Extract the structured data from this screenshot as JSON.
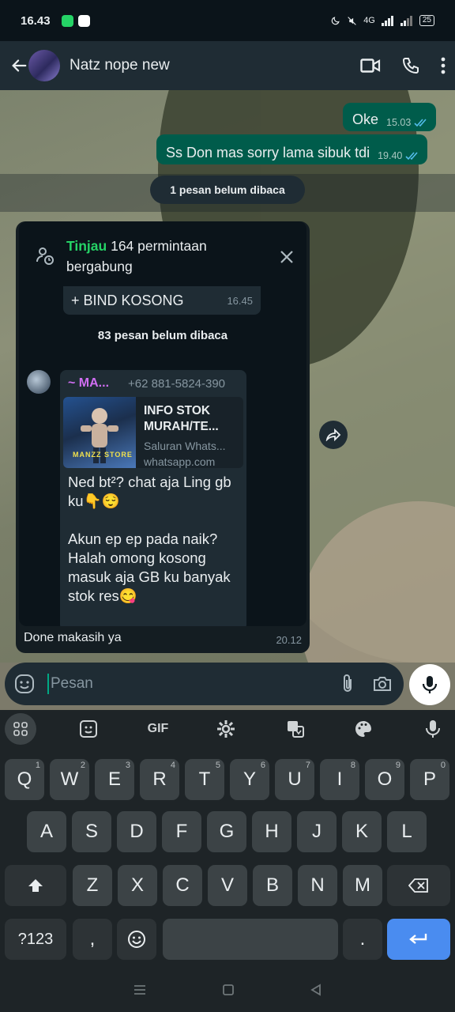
{
  "status_bar": {
    "time": "16.43",
    "signal_text": "4G",
    "battery": "25",
    "app_colors": [
      "#25d366",
      "#ffffff"
    ]
  },
  "top_bar": {
    "contact_name": "Natz nope new",
    "icons": [
      "back-arrow-icon",
      "video-call-icon",
      "voice-call-icon",
      "more-options-icon"
    ]
  },
  "chat": {
    "outgoing": [
      {
        "text": "Oke",
        "time": "15.03",
        "status": "read"
      },
      {
        "text": "Ss Don mas sorry lama sibuk tdi",
        "time": "19.40",
        "status": "read"
      }
    ],
    "unread_banner": "1 pesan belum dibaca",
    "screenshot_message": {
      "request_link": "Tinjau",
      "request_text": " 164 permintaan bergabung",
      "bind_text": "+ BIND KOSONG",
      "bind_time": "16.45",
      "inner_unread": "83 pesan belum dibaca",
      "sender": "~ MA...",
      "phone": "+62 881-5824-390",
      "link_title": "INFO STOK MURAH/TE...",
      "link_desc1": "Saluran Whats...",
      "link_desc2": "whatsapp.com",
      "thumb_label": "MANZZ STORE",
      "body": "Ned bt²? chat aja Ling gb ku👇😌\n\nAkun ep ep pada naik? Halah omong kosong masuk aja GB ku banyak stok res😋",
      "caption": "Done makasih ya",
      "time": "20.12"
    }
  },
  "composer": {
    "placeholder": "Pesan"
  },
  "keyboard": {
    "toolbar": [
      "apps-icon",
      "sticker-icon",
      "GIF",
      "settings-icon",
      "translate-icon",
      "theme-icon",
      "mic-icon"
    ],
    "gif_label": "GIF",
    "row1": [
      {
        "k": "Q",
        "h": "1"
      },
      {
        "k": "W",
        "h": "2"
      },
      {
        "k": "E",
        "h": "3"
      },
      {
        "k": "R",
        "h": "4"
      },
      {
        "k": "T",
        "h": "5"
      },
      {
        "k": "Y",
        "h": "6"
      },
      {
        "k": "U",
        "h": "7"
      },
      {
        "k": "I",
        "h": "8"
      },
      {
        "k": "O",
        "h": "9"
      },
      {
        "k": "P",
        "h": "0"
      }
    ],
    "row2": [
      "A",
      "S",
      "D",
      "F",
      "G",
      "H",
      "J",
      "K",
      "L"
    ],
    "row3": [
      "Z",
      "X",
      "C",
      "V",
      "B",
      "N",
      "M"
    ],
    "symbols": "?123",
    "comma": ",",
    "period": "."
  }
}
